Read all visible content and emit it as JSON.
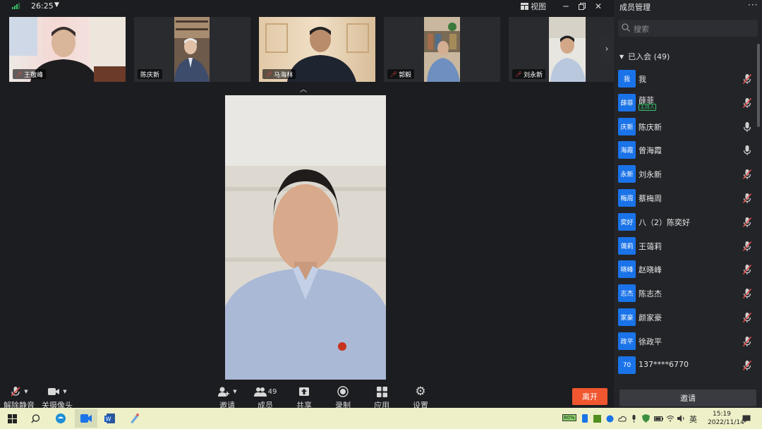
{
  "topbar": {
    "timer": "26:25",
    "view_label": "视图"
  },
  "thumbnails": [
    {
      "name": "王敬峰",
      "muted": true
    },
    {
      "name": "陈庆新",
      "muted": false
    },
    {
      "name": "马海林",
      "muted": true
    },
    {
      "name": "郭毅",
      "muted": true
    },
    {
      "name": "刘永新",
      "muted": true
    }
  ],
  "toolbar": {
    "unmute": "解除静音",
    "camera": "关摄像头",
    "invite": "邀请",
    "members": "成员",
    "members_count": "49",
    "share": "共享",
    "record": "录制",
    "apps": "应用",
    "settings": "设置",
    "leave": "离开"
  },
  "panel": {
    "title": "成员管理",
    "search_placeholder": "搜索",
    "group_label": "已入会 (49)",
    "invite_button": "邀请",
    "members": [
      {
        "avatar": "我",
        "name": "我",
        "mic": "muted"
      },
      {
        "avatar": "薛菲",
        "name": "薛菲",
        "badge": "主持人",
        "mic": "muted"
      },
      {
        "avatar": "庆新",
        "name": "陈庆新",
        "mic": "on"
      },
      {
        "avatar": "海霞",
        "name": "曾海霞",
        "mic": "on"
      },
      {
        "avatar": "永新",
        "name": "刘永新",
        "mic": "muted"
      },
      {
        "avatar": "梅周",
        "name": "蔡梅周",
        "mic": "muted"
      },
      {
        "avatar": "奕好",
        "name": "八（2）陈奕好",
        "mic": "muted"
      },
      {
        "avatar": "蔼莉",
        "name": "王蔼莉",
        "mic": "muted"
      },
      {
        "avatar": "晓峰",
        "name": "赵晓峰",
        "mic": "muted"
      },
      {
        "avatar": "志杰",
        "name": "陈志杰",
        "mic": "muted"
      },
      {
        "avatar": "家豪",
        "name": "颜家豪",
        "mic": "muted"
      },
      {
        "avatar": "政平",
        "name": "徐政平",
        "mic": "muted"
      },
      {
        "avatar": "70",
        "name": "137****6770",
        "mic": "muted"
      }
    ]
  },
  "taskbar": {
    "battery": "80%",
    "ime": "英",
    "time": "15:19",
    "date": "2022/11/14"
  },
  "colors": {
    "accent": "#1a73e8",
    "leave": "#f0562f",
    "muted": "#e04848",
    "host": "#37c26b",
    "taskbar": "#eef0c8"
  }
}
